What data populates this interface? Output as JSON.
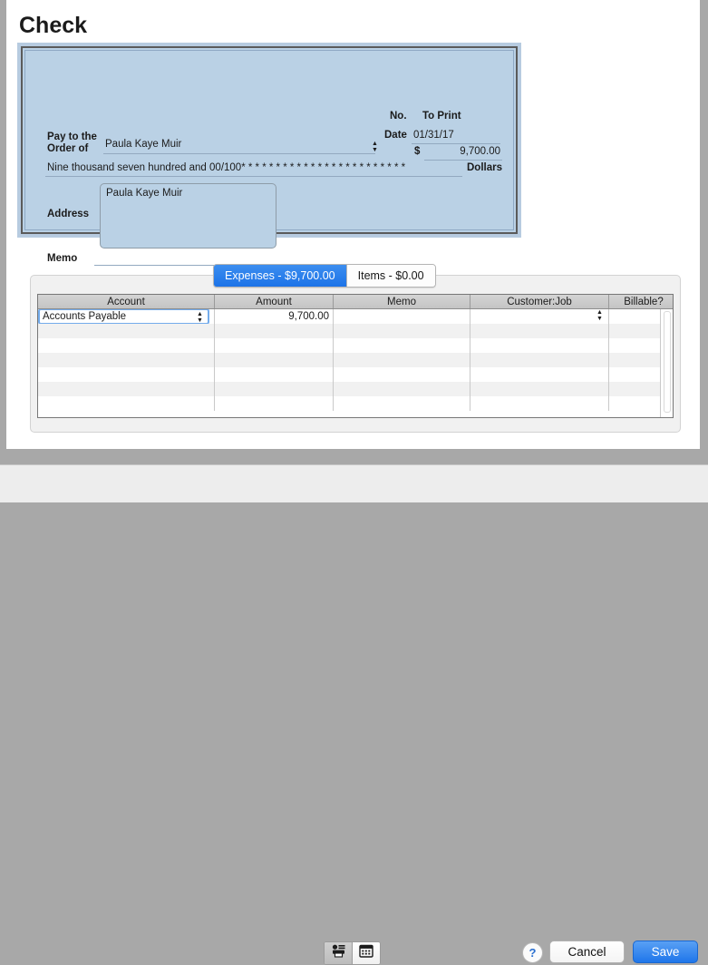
{
  "window": {
    "title": "Check"
  },
  "check": {
    "pay_to_label": "Pay to the",
    "order_of_label": "Order of",
    "payee": "Paula Kaye Muir",
    "no_label": "No.",
    "no_value": "To Print",
    "date_label": "Date",
    "date_value": "01/31/17",
    "currency_symbol": "$",
    "amount": "9,700.00",
    "amount_in_words": "Nine thousand seven hundred and 00/100* * * * * * * * * * * * * * * * * * * * * * * *",
    "dollars_label": "Dollars",
    "address_label": "Address",
    "address_value": "Paula Kaye Muir",
    "memo_label": "Memo",
    "memo_value": ""
  },
  "tabs": [
    {
      "label": "Expenses - $9,700.00",
      "active": true
    },
    {
      "label": "Items - $0.00",
      "active": false
    }
  ],
  "table": {
    "columns": [
      "Account",
      "Amount",
      "Memo",
      "Customer:Job",
      "Billable?"
    ],
    "rows": [
      {
        "account": "Accounts Payable",
        "amount": "9,700.00",
        "memo": "",
        "customer_job": "",
        "billable": ""
      },
      {
        "account": "",
        "amount": "",
        "memo": "",
        "customer_job": "",
        "billable": ""
      },
      {
        "account": "",
        "amount": "",
        "memo": "",
        "customer_job": "",
        "billable": ""
      },
      {
        "account": "",
        "amount": "",
        "memo": "",
        "customer_job": "",
        "billable": ""
      },
      {
        "account": "",
        "amount": "",
        "memo": "",
        "customer_job": "",
        "billable": ""
      },
      {
        "account": "",
        "amount": "",
        "memo": "",
        "customer_job": "",
        "billable": ""
      },
      {
        "account": "",
        "amount": "",
        "memo": "",
        "customer_job": "",
        "billable": ""
      }
    ]
  },
  "footer": {
    "print_later_icon": "print-icon",
    "calendar_icon": "calendar-icon",
    "help_label": "?",
    "cancel_label": "Cancel",
    "save_label": "Save"
  },
  "colors": {
    "check_background": "#bad1e5",
    "accent_blue": "#2a7fec",
    "header_gray": "#cccccc",
    "band_gray": "#a8a8a8",
    "footer_gray": "#ededed"
  }
}
